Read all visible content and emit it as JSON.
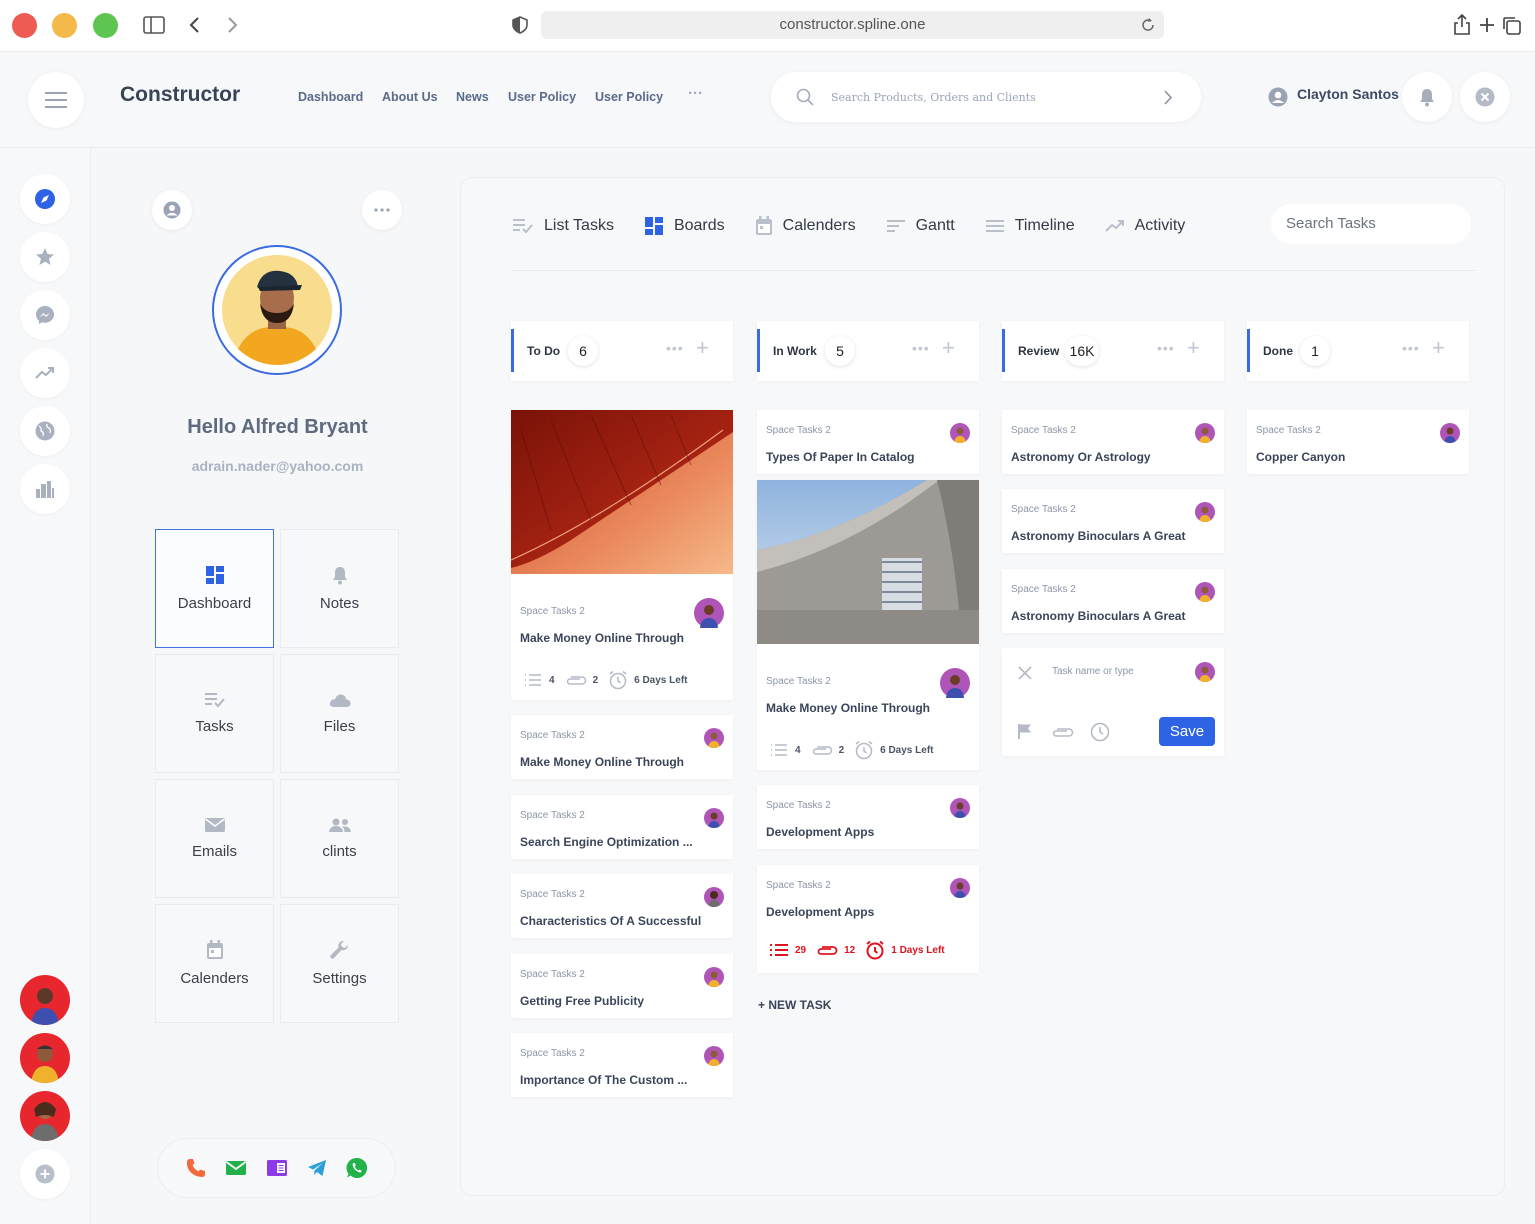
{
  "browser": {
    "url": "constructor.spline.one"
  },
  "header": {
    "brand": "Constructor",
    "nav": [
      "Dashboard",
      "About Us",
      "News",
      "User Policy",
      "User Policy"
    ],
    "more": "···",
    "search_placeholder": "Search Products, Orders and Clients",
    "user_name": "Clayton Santos"
  },
  "profile": {
    "name": "Hello Alfred Bryant",
    "email": "adrain.nader@yahoo.com",
    "tiles": [
      "Dashboard",
      "Notes",
      "Tasks",
      "Files",
      "Emails",
      "clints",
      "Calenders",
      "Settings"
    ]
  },
  "board": {
    "tabs": [
      "List Tasks",
      "Boards",
      "Calenders",
      "Gantt",
      "Timeline",
      "Activity"
    ],
    "search_placeholder": "Search Tasks",
    "columns": [
      {
        "title": "To Do",
        "count": "6"
      },
      {
        "title": "In Work",
        "count": "5"
      },
      {
        "title": "Review",
        "count": "16K"
      },
      {
        "title": "Done",
        "count": "1"
      }
    ],
    "project_label": "Space Tasks 2",
    "todo": [
      {
        "title": "Make Money Online Through",
        "tasks": "4",
        "clips": "2",
        "due": "6 Days Left"
      },
      {
        "title": "Make Money Online Through"
      },
      {
        "title": "Search Engine Optimization ..."
      },
      {
        "title": "Characteristics Of A Successful"
      },
      {
        "title": "Getting Free Publicity"
      },
      {
        "title": "Importance Of The Custom ..."
      }
    ],
    "inwork": [
      {
        "title": "Types Of Paper In Catalog"
      },
      {
        "title": "Make Money Online Through",
        "tasks": "4",
        "clips": "2",
        "due": "6 Days Left"
      },
      {
        "title": "Development Apps"
      },
      {
        "title": "Development Apps",
        "tasks": "29",
        "clips": "12",
        "due": "1 Days Left"
      }
    ],
    "review": [
      {
        "title": "Astronomy Or Astrology"
      },
      {
        "title": "Astronomy Binoculars A Great"
      },
      {
        "title": "Astronomy Binoculars A Great"
      }
    ],
    "done": [
      {
        "title": "Copper Canyon"
      }
    ],
    "new_card": {
      "placeholder": "Task name or type",
      "save": "Save"
    },
    "new_task": "+ NEW TASK"
  },
  "colors": {
    "accent": "#2f63e6",
    "urgent": "#e0141f",
    "avatar_bg": "#b055b8"
  }
}
